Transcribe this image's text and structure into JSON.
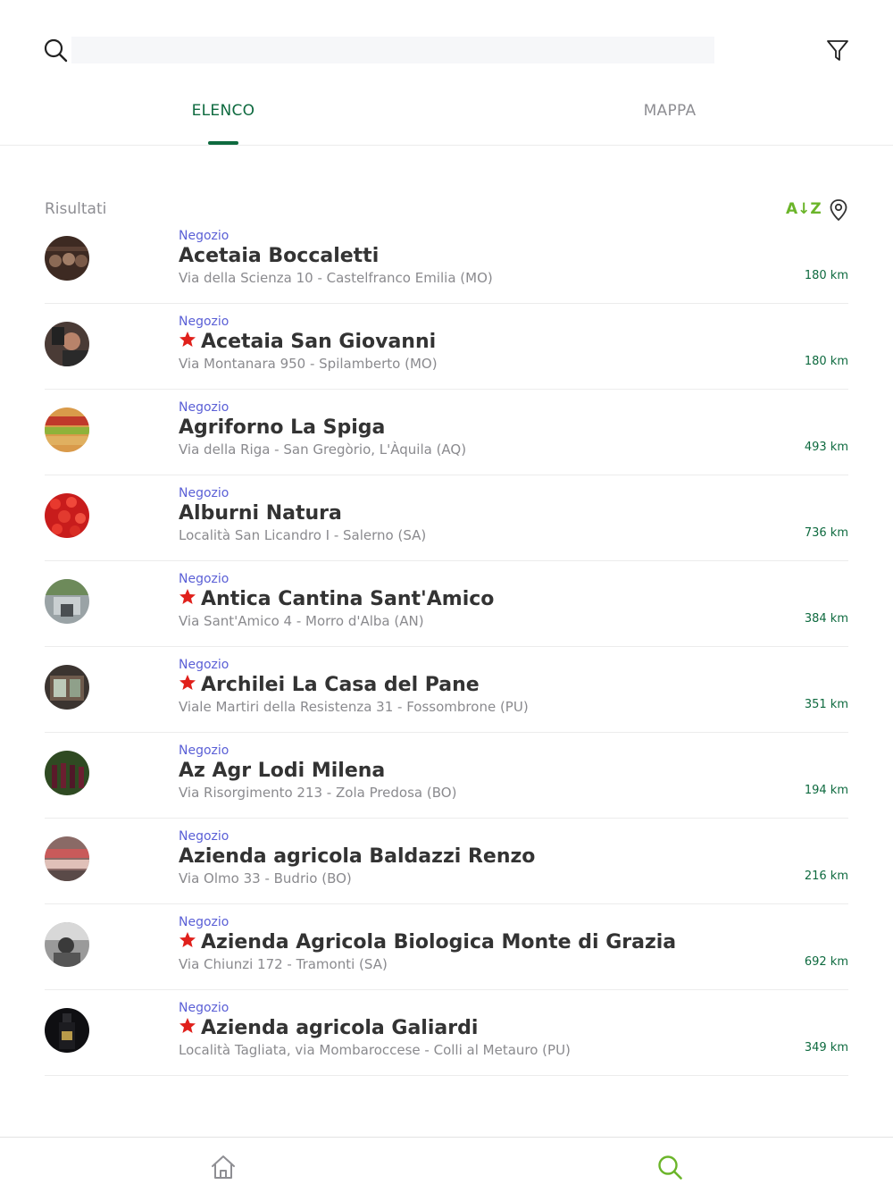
{
  "search": {
    "placeholder": "",
    "value": ""
  },
  "icons": {
    "search": "search-icon",
    "filter": "filter-icon",
    "sort": "sort-az",
    "location": "map-pin-icon",
    "favorite": "star-icon",
    "home": "home-icon"
  },
  "tabs": [
    {
      "label": "ELENCO",
      "active": true
    },
    {
      "label": "MAPPA",
      "active": false
    }
  ],
  "results": {
    "label": "Risultati",
    "sort_label": "A↓Z"
  },
  "colors": {
    "accent_green": "#0e6a3f",
    "sort_green": "#6bb52a",
    "type_blue": "#5a5fd6",
    "star_red": "#e0201b"
  },
  "items": [
    {
      "type": "Negozio",
      "name": "Acetaia Boccaletti",
      "address": "Via della Scienza 10 - Castelfranco Emilia (MO)",
      "distance": "180 km",
      "starred": false
    },
    {
      "type": "Negozio",
      "name": "Acetaia San Giovanni",
      "address": "Via Montanara 950 - Spilamberto (MO)",
      "distance": "180 km",
      "starred": true
    },
    {
      "type": "Negozio",
      "name": "Agriforno La Spiga",
      "address": "Via della Riga - San Gregòrio, L'Àquila (AQ)",
      "distance": "493 km",
      "starred": false
    },
    {
      "type": "Negozio",
      "name": "Alburni Natura",
      "address": "Località San Licandro I - Salerno (SA)",
      "distance": "736 km",
      "starred": false
    },
    {
      "type": "Negozio",
      "name": "Antica Cantina Sant'Amico",
      "address": "Via Sant'Amico 4 - Morro d'Alba (AN)",
      "distance": "384 km",
      "starred": true
    },
    {
      "type": "Negozio",
      "name": "Archilei La Casa del Pane",
      "address": "Viale Martiri della Resistenza 31 - Fossombrone (PU)",
      "distance": "351 km",
      "starred": true
    },
    {
      "type": "Negozio",
      "name": "Az Agr Lodi Milena",
      "address": "Via Risorgimento 213 - Zola Predosa (BO)",
      "distance": "194 km",
      "starred": false
    },
    {
      "type": "Negozio",
      "name": "Azienda agricola Baldazzi Renzo",
      "address": "Via Olmo 33 - Budrio (BO)",
      "distance": "216 km",
      "starred": false
    },
    {
      "type": "Negozio",
      "name": "Azienda Agricola Biologica Monte di Grazia",
      "address": "Via Chiunzi 172 - Tramonti (SA)",
      "distance": "692 km",
      "starred": true
    },
    {
      "type": "Negozio",
      "name": "Azienda agricola Galiardi",
      "address": "Località Tagliata, via Mombaroccese - Colli al Metauro (PU)",
      "distance": "349 km",
      "starred": true
    }
  ]
}
